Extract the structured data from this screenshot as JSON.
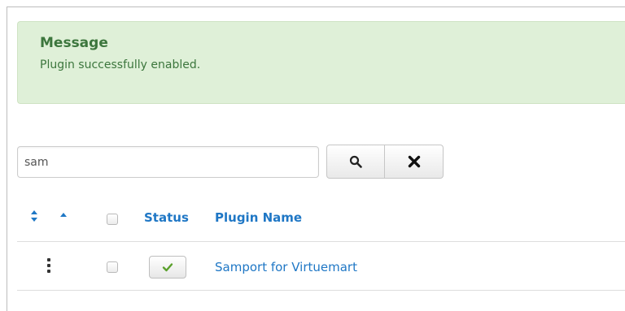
{
  "message": {
    "heading": "Message",
    "text": "Plugin successfully enabled.",
    "color": "#3c763d",
    "background": "#dff0d8"
  },
  "search": {
    "value": "sam",
    "search_button_icon": "search-icon",
    "clear_button_icon": "close-icon"
  },
  "table": {
    "columns": [
      {
        "icon": "sort-icon"
      },
      {
        "icon": "sort-asc-icon"
      },
      {
        "type": "checkbox"
      },
      {
        "label": "Status"
      },
      {
        "label": "Plugin Name"
      }
    ],
    "rows": [
      {
        "handle_icon": "drag-handle-icon",
        "checked": false,
        "status_icon": "check-icon",
        "status_enabled": true,
        "name": "Samport for Virtuemart"
      }
    ]
  },
  "colors": {
    "link": "#1f77c5",
    "check": "#5aa02c"
  }
}
